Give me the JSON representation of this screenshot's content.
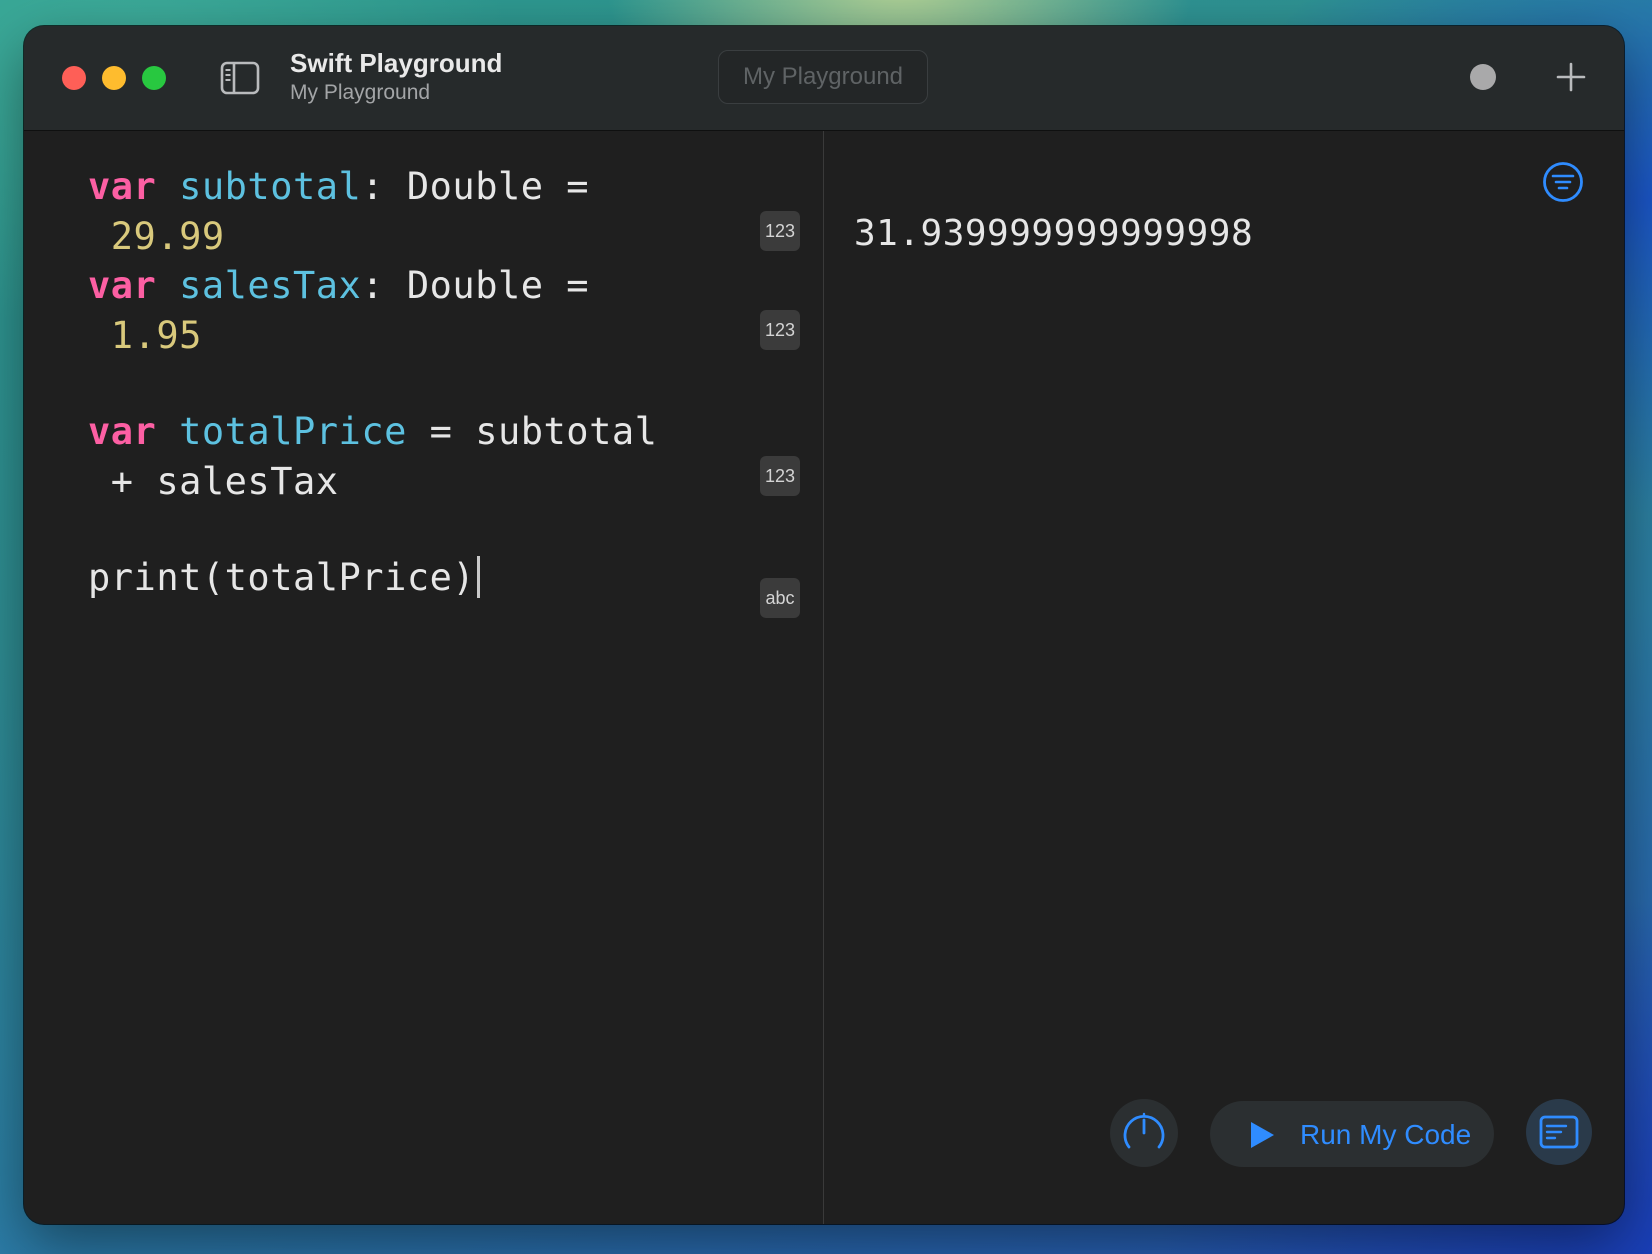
{
  "window": {
    "title": "Swift Playground",
    "subtitle": "My Playground",
    "center_field": "My Playground"
  },
  "editor": {
    "lines": [
      {
        "kw": "var",
        "ident": "subtotal",
        "rest": ": Double =",
        "cont": "29.99",
        "badge": "123"
      },
      {
        "kw": "var",
        "ident": "salesTax",
        "rest": ": Double =",
        "cont": "1.95",
        "badge": "123"
      },
      {
        "kw": "var",
        "ident": "totalPrice",
        "rest": " = subtotal",
        "cont": "+ salesTax",
        "badge": "123"
      },
      {
        "text": "print(totalPrice)",
        "badge": "abc"
      }
    ]
  },
  "console": {
    "output": "31.939999999999998"
  },
  "toolbar": {
    "run_label": "Run My Code"
  },
  "icons": {
    "sidebar": "sidebar-toggle-icon",
    "status": "status-dot-icon",
    "add": "plus-icon",
    "filter": "filter-icon",
    "gauge": "speedometer-icon",
    "run": "play-icon",
    "log": "console-log-icon"
  },
  "colors": {
    "keyword": "#fc5fa3",
    "identifier": "#5dc1e0",
    "number": "#d9c97c",
    "accent": "#2f8cff",
    "traffic_red": "#fe5f57",
    "traffic_yellow": "#febc2e",
    "traffic_green": "#28c840"
  }
}
